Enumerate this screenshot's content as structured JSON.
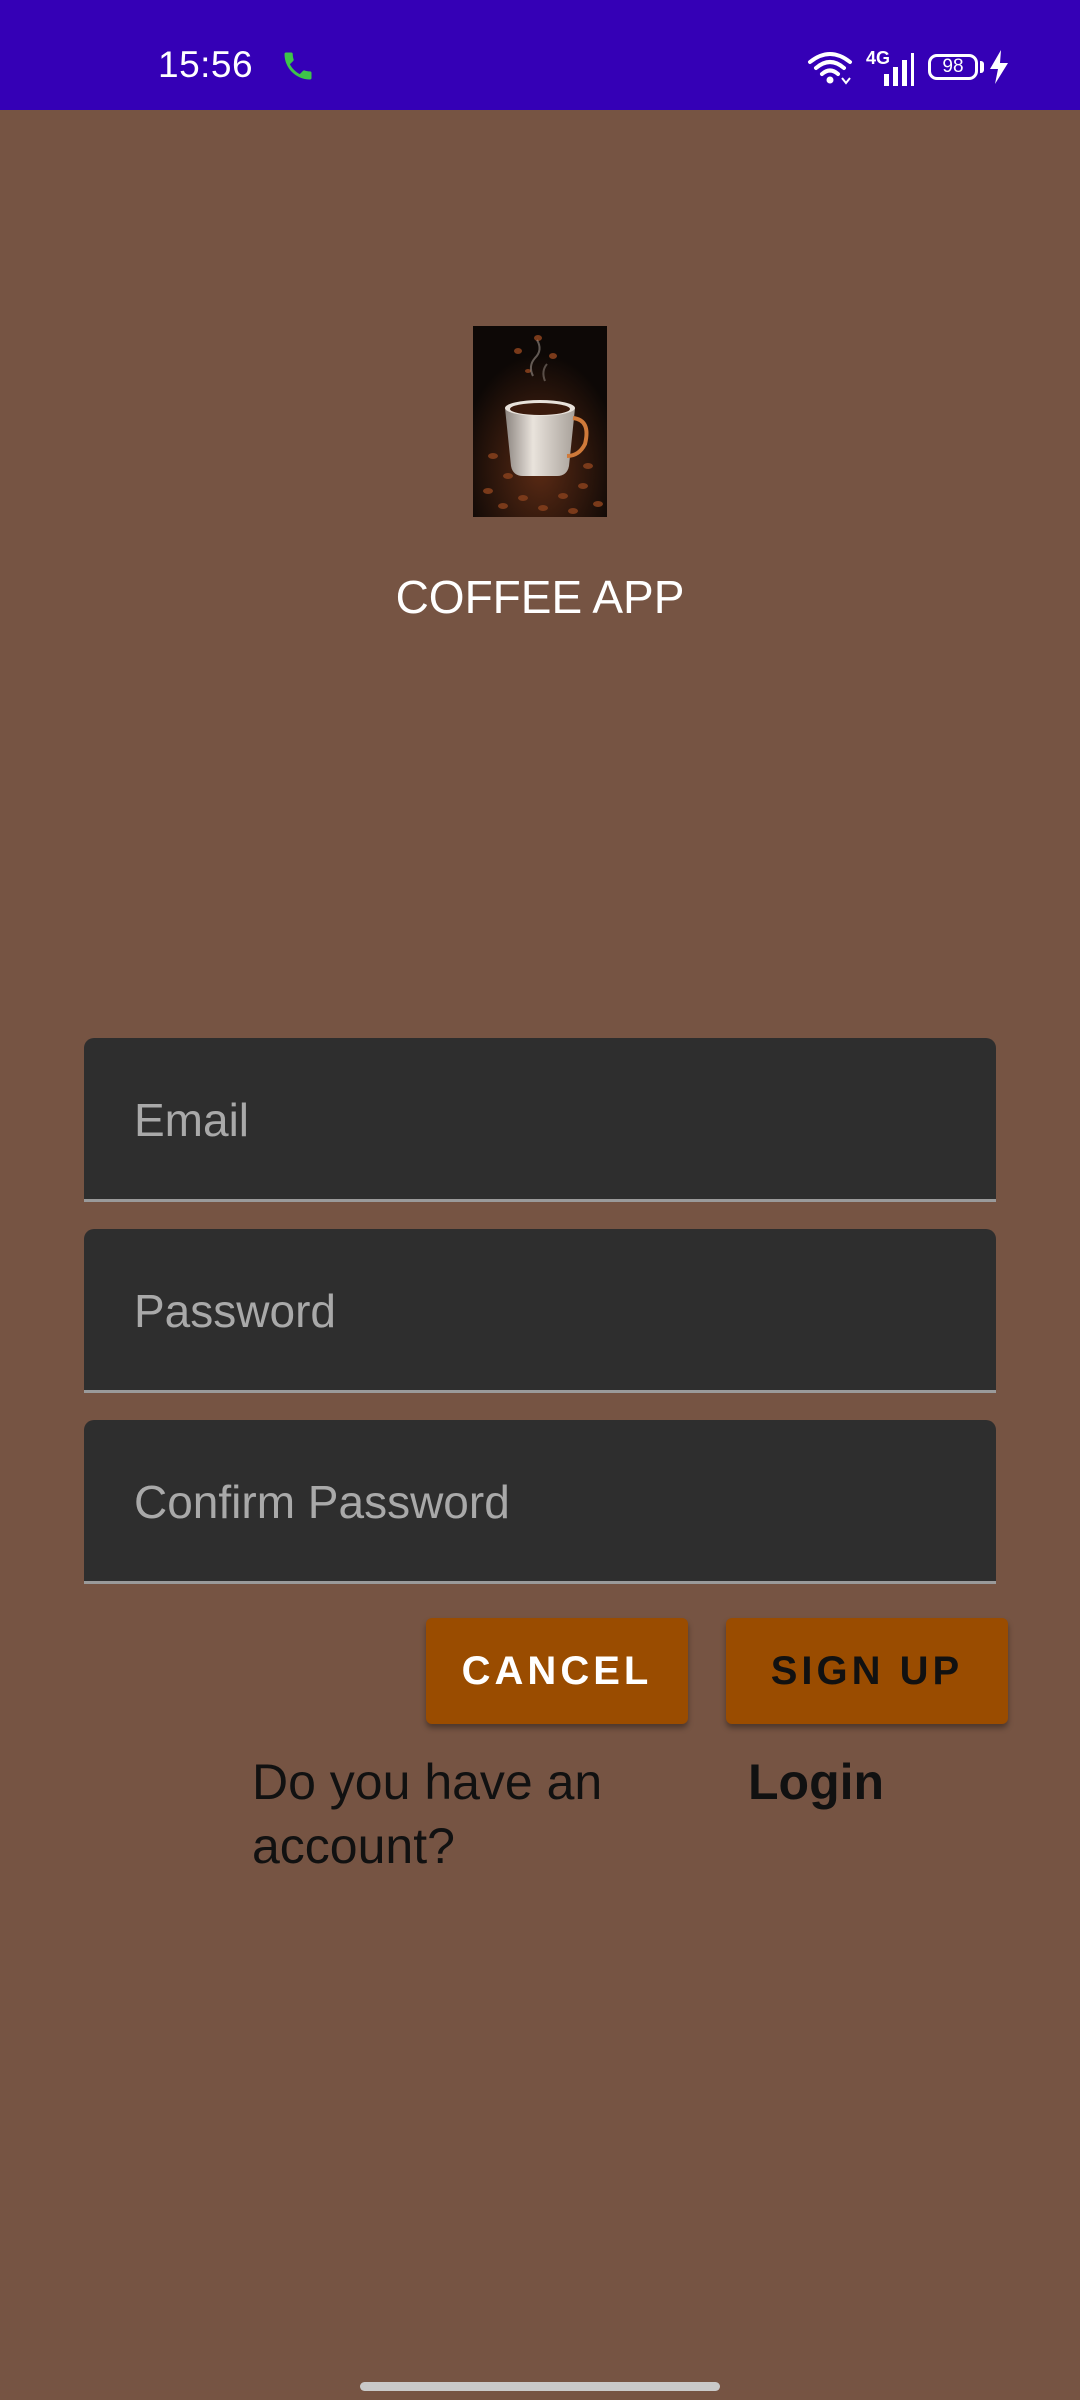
{
  "status_bar": {
    "time": "15:56",
    "network_type": "4G",
    "battery_level": "98",
    "icons": [
      "call-icon",
      "wifi-icon",
      "signal-icon",
      "battery-icon",
      "charging-icon"
    ]
  },
  "app": {
    "title": "COFFEE APP",
    "logo_icon": "coffee-cup-logo"
  },
  "form": {
    "email_placeholder": "Email",
    "email_value": "",
    "password_placeholder": "Password",
    "password_value": "",
    "confirm_password_placeholder": "Confirm Password",
    "confirm_password_value": ""
  },
  "actions": {
    "cancel_label": "CANCEL",
    "signup_label": "SIGN UP"
  },
  "footer": {
    "question": "Do you have an account?",
    "login_label": "Login"
  },
  "colors": {
    "status_bar": "#3500b6",
    "background": "#765443",
    "field": "#2e2e2e",
    "button": "#9a4c00"
  }
}
